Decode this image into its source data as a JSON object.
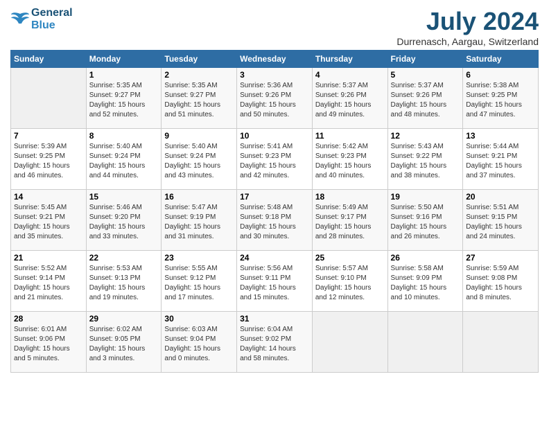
{
  "header": {
    "logo_line1": "General",
    "logo_line2": "Blue",
    "month": "July 2024",
    "location": "Durrenasch, Aargau, Switzerland"
  },
  "weekdays": [
    "Sunday",
    "Monday",
    "Tuesday",
    "Wednesday",
    "Thursday",
    "Friday",
    "Saturday"
  ],
  "weeks": [
    [
      {
        "day": "",
        "info": ""
      },
      {
        "day": "1",
        "info": "Sunrise: 5:35 AM\nSunset: 9:27 PM\nDaylight: 15 hours\nand 52 minutes."
      },
      {
        "day": "2",
        "info": "Sunrise: 5:35 AM\nSunset: 9:27 PM\nDaylight: 15 hours\nand 51 minutes."
      },
      {
        "day": "3",
        "info": "Sunrise: 5:36 AM\nSunset: 9:26 PM\nDaylight: 15 hours\nand 50 minutes."
      },
      {
        "day": "4",
        "info": "Sunrise: 5:37 AM\nSunset: 9:26 PM\nDaylight: 15 hours\nand 49 minutes."
      },
      {
        "day": "5",
        "info": "Sunrise: 5:37 AM\nSunset: 9:26 PM\nDaylight: 15 hours\nand 48 minutes."
      },
      {
        "day": "6",
        "info": "Sunrise: 5:38 AM\nSunset: 9:25 PM\nDaylight: 15 hours\nand 47 minutes."
      }
    ],
    [
      {
        "day": "7",
        "info": "Sunrise: 5:39 AM\nSunset: 9:25 PM\nDaylight: 15 hours\nand 46 minutes."
      },
      {
        "day": "8",
        "info": "Sunrise: 5:40 AM\nSunset: 9:24 PM\nDaylight: 15 hours\nand 44 minutes."
      },
      {
        "day": "9",
        "info": "Sunrise: 5:40 AM\nSunset: 9:24 PM\nDaylight: 15 hours\nand 43 minutes."
      },
      {
        "day": "10",
        "info": "Sunrise: 5:41 AM\nSunset: 9:23 PM\nDaylight: 15 hours\nand 42 minutes."
      },
      {
        "day": "11",
        "info": "Sunrise: 5:42 AM\nSunset: 9:23 PM\nDaylight: 15 hours\nand 40 minutes."
      },
      {
        "day": "12",
        "info": "Sunrise: 5:43 AM\nSunset: 9:22 PM\nDaylight: 15 hours\nand 38 minutes."
      },
      {
        "day": "13",
        "info": "Sunrise: 5:44 AM\nSunset: 9:21 PM\nDaylight: 15 hours\nand 37 minutes."
      }
    ],
    [
      {
        "day": "14",
        "info": "Sunrise: 5:45 AM\nSunset: 9:21 PM\nDaylight: 15 hours\nand 35 minutes."
      },
      {
        "day": "15",
        "info": "Sunrise: 5:46 AM\nSunset: 9:20 PM\nDaylight: 15 hours\nand 33 minutes."
      },
      {
        "day": "16",
        "info": "Sunrise: 5:47 AM\nSunset: 9:19 PM\nDaylight: 15 hours\nand 31 minutes."
      },
      {
        "day": "17",
        "info": "Sunrise: 5:48 AM\nSunset: 9:18 PM\nDaylight: 15 hours\nand 30 minutes."
      },
      {
        "day": "18",
        "info": "Sunrise: 5:49 AM\nSunset: 9:17 PM\nDaylight: 15 hours\nand 28 minutes."
      },
      {
        "day": "19",
        "info": "Sunrise: 5:50 AM\nSunset: 9:16 PM\nDaylight: 15 hours\nand 26 minutes."
      },
      {
        "day": "20",
        "info": "Sunrise: 5:51 AM\nSunset: 9:15 PM\nDaylight: 15 hours\nand 24 minutes."
      }
    ],
    [
      {
        "day": "21",
        "info": "Sunrise: 5:52 AM\nSunset: 9:14 PM\nDaylight: 15 hours\nand 21 minutes."
      },
      {
        "day": "22",
        "info": "Sunrise: 5:53 AM\nSunset: 9:13 PM\nDaylight: 15 hours\nand 19 minutes."
      },
      {
        "day": "23",
        "info": "Sunrise: 5:55 AM\nSunset: 9:12 PM\nDaylight: 15 hours\nand 17 minutes."
      },
      {
        "day": "24",
        "info": "Sunrise: 5:56 AM\nSunset: 9:11 PM\nDaylight: 15 hours\nand 15 minutes."
      },
      {
        "day": "25",
        "info": "Sunrise: 5:57 AM\nSunset: 9:10 PM\nDaylight: 15 hours\nand 12 minutes."
      },
      {
        "day": "26",
        "info": "Sunrise: 5:58 AM\nSunset: 9:09 PM\nDaylight: 15 hours\nand 10 minutes."
      },
      {
        "day": "27",
        "info": "Sunrise: 5:59 AM\nSunset: 9:08 PM\nDaylight: 15 hours\nand 8 minutes."
      }
    ],
    [
      {
        "day": "28",
        "info": "Sunrise: 6:01 AM\nSunset: 9:06 PM\nDaylight: 15 hours\nand 5 minutes."
      },
      {
        "day": "29",
        "info": "Sunrise: 6:02 AM\nSunset: 9:05 PM\nDaylight: 15 hours\nand 3 minutes."
      },
      {
        "day": "30",
        "info": "Sunrise: 6:03 AM\nSunset: 9:04 PM\nDaylight: 15 hours\nand 0 minutes."
      },
      {
        "day": "31",
        "info": "Sunrise: 6:04 AM\nSunset: 9:02 PM\nDaylight: 14 hours\nand 58 minutes."
      },
      {
        "day": "",
        "info": ""
      },
      {
        "day": "",
        "info": ""
      },
      {
        "day": "",
        "info": ""
      }
    ]
  ]
}
